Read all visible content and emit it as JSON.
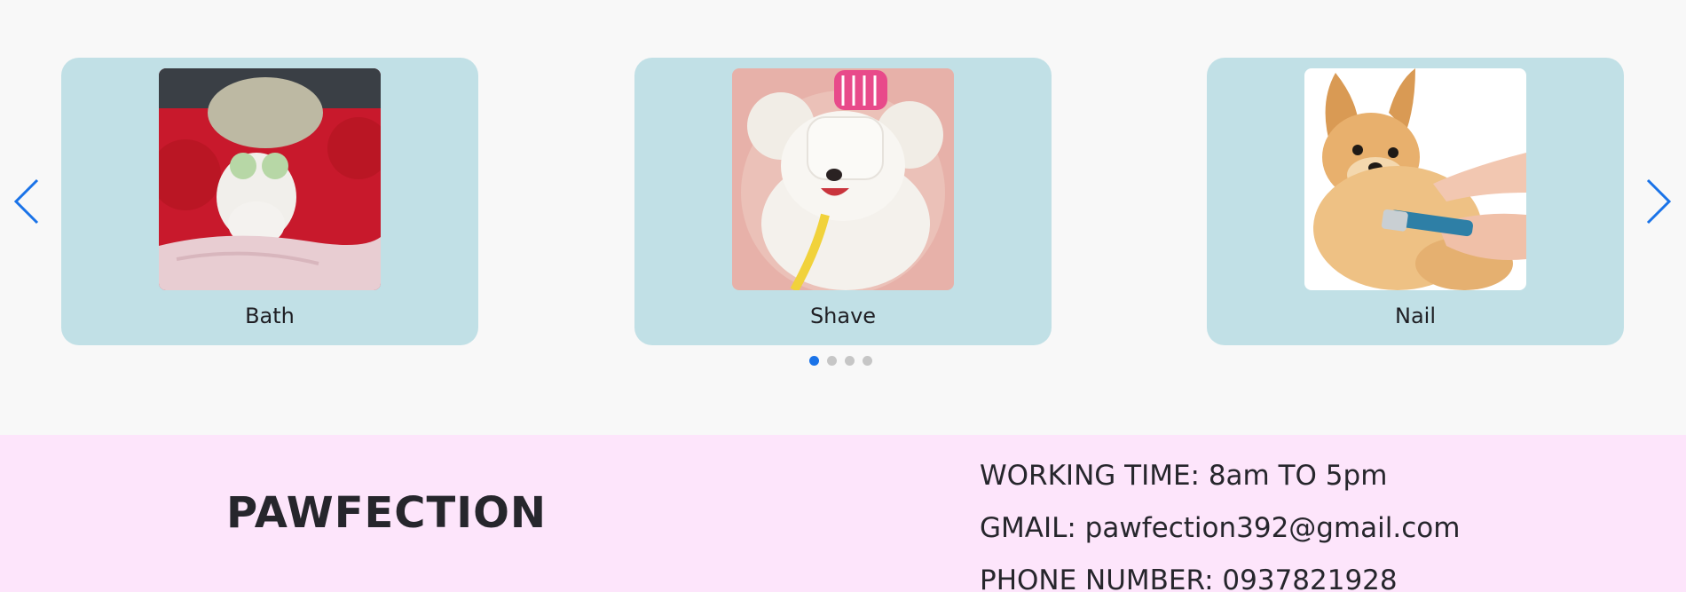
{
  "carousel": {
    "cards": [
      {
        "label": "Bath",
        "image": "cat-with-towel-and-cucumbers"
      },
      {
        "label": "Shave",
        "image": "fluffy-white-dog-with-face-mask"
      },
      {
        "label": "Nail",
        "image": "pomeranian-getting-nails-trimmed"
      }
    ],
    "prev_icon": "chevron-left-icon",
    "next_icon": "chevron-right-icon",
    "dots": [
      true,
      false,
      false,
      false
    ],
    "accent_color": "#1a73e8",
    "card_color": "#c1e0e6"
  },
  "footer": {
    "brand": "PAWFECTION",
    "working_time": "WORKING TIME: 8am TO 5pm",
    "gmail": "GMAIL: pawfection392@gmail.com",
    "phone": "PHONE NUMBER: 0937821928",
    "background_color": "#fde5fb"
  }
}
